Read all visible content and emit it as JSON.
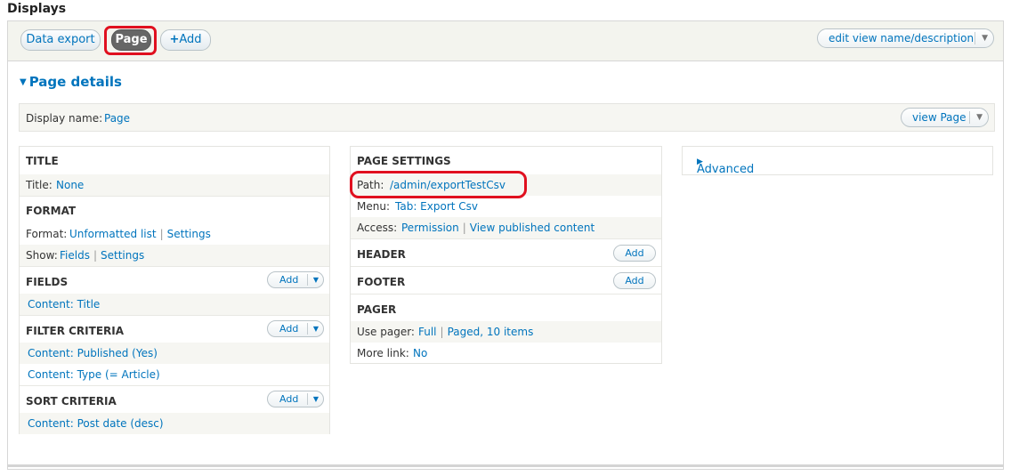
{
  "heading": "Displays",
  "tabs": [
    {
      "label": "Data export"
    },
    {
      "label": "Page"
    },
    {
      "label": "Add",
      "icon": "plus-icon"
    }
  ],
  "edit_view_button": "edit view name/description",
  "page_details": {
    "title": "Page details",
    "display_name_label": "Display name:",
    "display_name_value": "Page",
    "view_button": "view Page"
  },
  "left": {
    "title_section": "TITLE",
    "title_label": "Title:",
    "title_value": "None",
    "format_section": "FORMAT",
    "format_label": "Format:",
    "format_value": "Unformatted list",
    "format_settings": "Settings",
    "show_label": "Show:",
    "show_value": "Fields",
    "show_settings": "Settings",
    "fields_section": "FIELDS",
    "fields_add": "Add",
    "fields_item": "Content: Title",
    "filter_section": "FILTER CRITERIA",
    "filter_add": "Add",
    "filter_items": [
      "Content: Published (Yes)",
      "Content: Type (= Article)"
    ],
    "sort_section": "SORT CRITERIA",
    "sort_add": "Add",
    "sort_item": "Content: Post date (desc)"
  },
  "middle": {
    "page_settings": "PAGE SETTINGS",
    "path_label": "Path:",
    "path_value": "/admin/exportTestCsv",
    "menu_label": "Menu:",
    "menu_value": "Tab: Export Csv",
    "access_label": "Access:",
    "access_value": "Permission",
    "access_link": "View published content",
    "header_section": "HEADER",
    "header_add": "Add",
    "footer_section": "FOOTER",
    "footer_add": "Add",
    "pager_section": "PAGER",
    "use_pager_label": "Use pager:",
    "use_pager_value": "Full",
    "use_pager_link": "Paged, 10 items",
    "more_link_label": "More link:",
    "more_link_value": "No"
  },
  "right": {
    "advanced": "Advanced"
  },
  "colors": {
    "link": "#0074bd",
    "highlight": "#e0101f",
    "active_tab": "#666666"
  }
}
